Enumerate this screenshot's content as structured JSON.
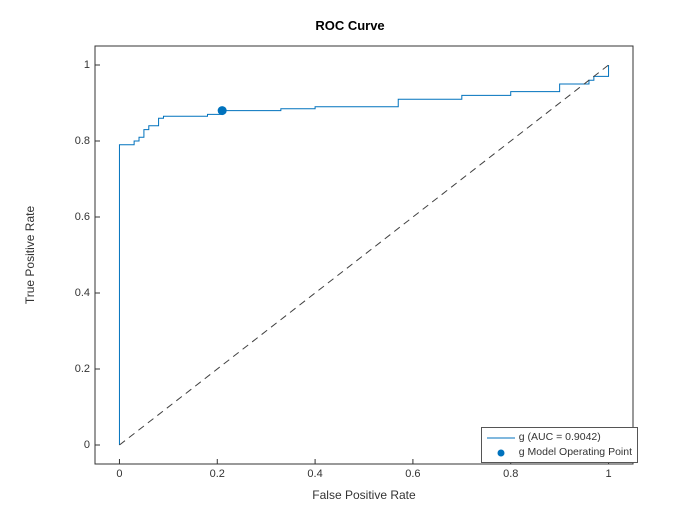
{
  "chart_data": {
    "type": "line",
    "title": "ROC Curve",
    "xlabel": "False Positive Rate",
    "ylabel": "True Positive Rate",
    "xlim": [
      -0.05,
      1.05
    ],
    "ylim": [
      -0.05,
      1.05
    ],
    "xticks": [
      0,
      0.2,
      0.4,
      0.6,
      0.8,
      1
    ],
    "yticks": [
      0,
      0.2,
      0.4,
      0.6,
      0.8,
      1
    ],
    "series": [
      {
        "name": "g (AUC = 0.9042)",
        "type": "step",
        "color": "#0072BD",
        "x": [
          0,
          0,
          0.01,
          0.03,
          0.04,
          0.05,
          0.06,
          0.08,
          0.08,
          0.09,
          0.09,
          0.18,
          0.21,
          0.33,
          0.4,
          0.5,
          0.5,
          0.57,
          0.63,
          0.7,
          0.73,
          0.8,
          0.9,
          0.9,
          0.96,
          0.97,
          1.0,
          1.0
        ],
        "y": [
          0,
          0.79,
          0.79,
          0.8,
          0.81,
          0.83,
          0.84,
          0.84,
          0.86,
          0.86,
          0.865,
          0.87,
          0.88,
          0.885,
          0.89,
          0.89,
          0.89,
          0.91,
          0.91,
          0.92,
          0.92,
          0.93,
          0.94,
          0.95,
          0.96,
          0.97,
          0.97,
          1.0
        ]
      },
      {
        "name": "g Model Operating Point",
        "type": "point",
        "color": "#0072BD",
        "x": [
          0.21
        ],
        "y": [
          0.88
        ]
      },
      {
        "name": "reference",
        "type": "dashed",
        "color": "#404040",
        "x": [
          0,
          1
        ],
        "y": [
          0,
          1
        ]
      }
    ],
    "legend": {
      "entries": [
        {
          "label": "g (AUC = 0.9042)",
          "style": "line",
          "color": "#0072BD"
        },
        {
          "label": "g Model Operating Point",
          "style": "dot",
          "color": "#0072BD"
        }
      ]
    }
  }
}
